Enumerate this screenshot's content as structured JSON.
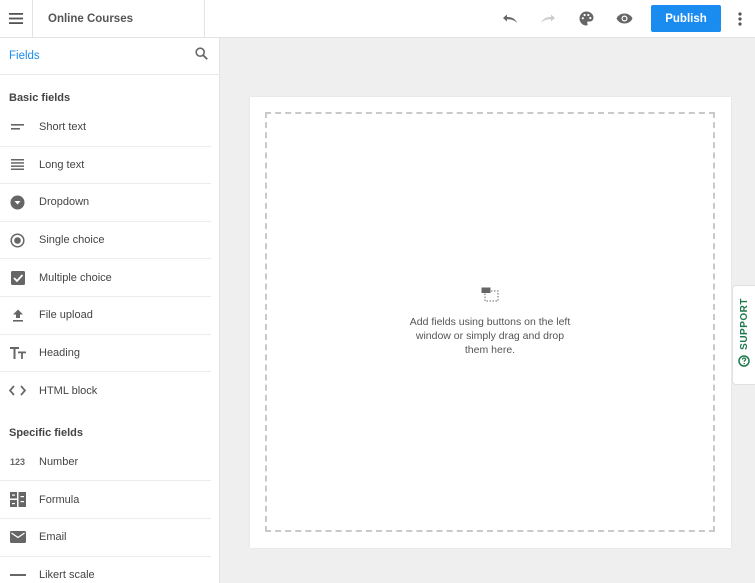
{
  "header": {
    "form_title": "Online Courses",
    "publish_label": "Publish",
    "accent_color": "#1a8cf0"
  },
  "sidebar": {
    "title": "Fields",
    "sections": [
      {
        "title": "Basic fields",
        "items": [
          {
            "label": "Short text",
            "icon": "short-text-icon"
          },
          {
            "label": "Long text",
            "icon": "long-text-icon"
          },
          {
            "label": "Dropdown",
            "icon": "dropdown-icon"
          },
          {
            "label": "Single choice",
            "icon": "radio-icon"
          },
          {
            "label": "Multiple choice",
            "icon": "checkbox-icon"
          },
          {
            "label": "File upload",
            "icon": "upload-icon"
          },
          {
            "label": "Heading",
            "icon": "heading-icon"
          },
          {
            "label": "HTML block",
            "icon": "code-icon"
          }
        ]
      },
      {
        "title": "Specific fields",
        "items": [
          {
            "label": "Number",
            "icon": "number-icon",
            "icon_text": "123"
          },
          {
            "label": "Formula",
            "icon": "formula-icon"
          },
          {
            "label": "Email",
            "icon": "email-icon"
          },
          {
            "label": "Likert scale",
            "icon": "likert-icon"
          }
        ]
      }
    ]
  },
  "canvas": {
    "drop_hint": "Add fields using buttons on the left window or simply drag and drop them here."
  },
  "support": {
    "label": "SUPPORT",
    "color": "#1e7a4c"
  }
}
